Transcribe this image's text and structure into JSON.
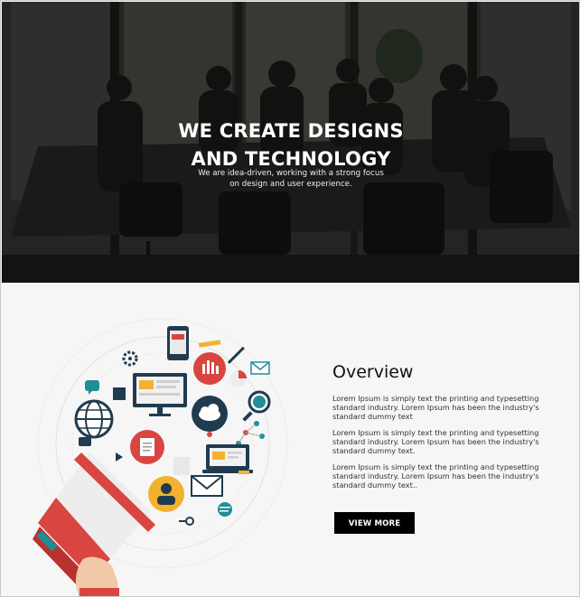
{
  "hero": {
    "title_line1": "WE CREATE DESIGNS",
    "title_line2": "AND TECHNOLOGY",
    "subtitle_line1": "We are idea-driven, working with a strong focus",
    "subtitle_line2": "on design and user experience.",
    "background_image": "team-meeting-photo"
  },
  "overview": {
    "title": "Overview",
    "paragraphs": [
      {
        "line1": "Lorem Ipsum is simply text the printing and typesetting",
        "line2": "standard industry. Lorem Ipsum has been the industry's",
        "line3": "standard dummy text"
      },
      {
        "line1": "Lorem Ipsum is simply text the printing and typesetting",
        "line2": "standard industry. Lorem Ipsum has been the industry's",
        "line3": "standard dummy text."
      },
      {
        "line1": "Lorem Ipsum is simply text the printing and typesetting",
        "line2": "standard industry. Lorem Ipsum has been the industry's",
        "line3": "standard dummy text.."
      }
    ],
    "button_label": "VIEW MORE"
  },
  "illustration": {
    "name": "digital-marketing-megaphone-illustration",
    "icons": [
      "smartphone-icon",
      "bar-chart-icon",
      "monitor-icon",
      "cloud-network-icon",
      "globe-icon",
      "document-icon",
      "laptop-icon",
      "user-avatar-icon",
      "envelope-icon",
      "magnifier-icon",
      "gear-icon",
      "chat-bubble-icon",
      "megaphone-icon",
      "hand-icon"
    ]
  },
  "colors": {
    "accent_red": "#d94540",
    "accent_teal": "#1e8f97",
    "accent_yellow": "#f2b230",
    "dark_navy": "#213b4e",
    "button_bg": "#000000"
  }
}
